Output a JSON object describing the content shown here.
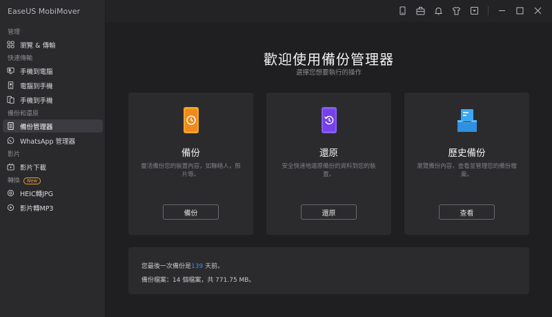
{
  "app": {
    "title": "EaseUS MobiMover"
  },
  "sidebar": {
    "sections": [
      {
        "label": "管理",
        "items": [
          {
            "label": "瀏覽 & 傳輸",
            "icon": "browse-icon",
            "active": false
          }
        ]
      },
      {
        "label": "快速傳輸",
        "items": [
          {
            "label": "手機到電腦",
            "icon": "phone-to-pc-icon",
            "active": false
          },
          {
            "label": "電腦到手機",
            "icon": "pc-to-phone-icon",
            "active": false
          },
          {
            "label": "手機到手機",
            "icon": "phone-to-phone-icon",
            "active": false
          }
        ]
      },
      {
        "label": "備份和還原",
        "items": [
          {
            "label": "備份管理器",
            "icon": "backup-manager-icon",
            "active": true
          },
          {
            "label": "WhatsApp 管理器",
            "icon": "whatsapp-icon",
            "active": false
          }
        ]
      },
      {
        "label": "影片",
        "items": [
          {
            "label": "影片下載",
            "icon": "video-download-icon",
            "active": false
          }
        ]
      },
      {
        "label": "轉換",
        "badge": "New",
        "items": [
          {
            "label": "HEIC轉JPG",
            "icon": "heic-convert-icon",
            "active": false
          },
          {
            "label": "影片轉MP3",
            "icon": "video-to-mp3-icon",
            "active": false
          }
        ]
      }
    ]
  },
  "titlebar": {
    "icons": [
      "device-icon",
      "toolbox-icon",
      "bell-icon",
      "shirt-icon",
      "download-box-icon",
      "minimize-icon",
      "maximize-icon",
      "close-icon"
    ]
  },
  "main": {
    "heading": "歡迎使用備份管理器",
    "subheading": "選擇您想要執行的操作",
    "cards": [
      {
        "title": "備份",
        "desc": "靈活備份您的裝置內容，如聯絡人，照片等。",
        "button": "備份",
        "icon": "backup-phone-icon",
        "color": "#f5a623"
      },
      {
        "title": "還原",
        "desc": "安全快速地還原備份的資料到您的裝置。",
        "button": "還原",
        "icon": "restore-phone-icon",
        "color": "#8b5cf6"
      },
      {
        "title": "歷史備份",
        "desc": "瀏覽備份內容，查看並管理您的備份檔案。",
        "button": "查看",
        "icon": "history-backup-icon",
        "color": "#2f9bf0"
      }
    ],
    "info": {
      "last_backup_prefix": "您最後一次備份是",
      "last_backup_days": "139",
      "last_backup_suffix": " 天前。",
      "files_line": "備份檔案：14 個檔案，共 771.75 MB。"
    }
  }
}
